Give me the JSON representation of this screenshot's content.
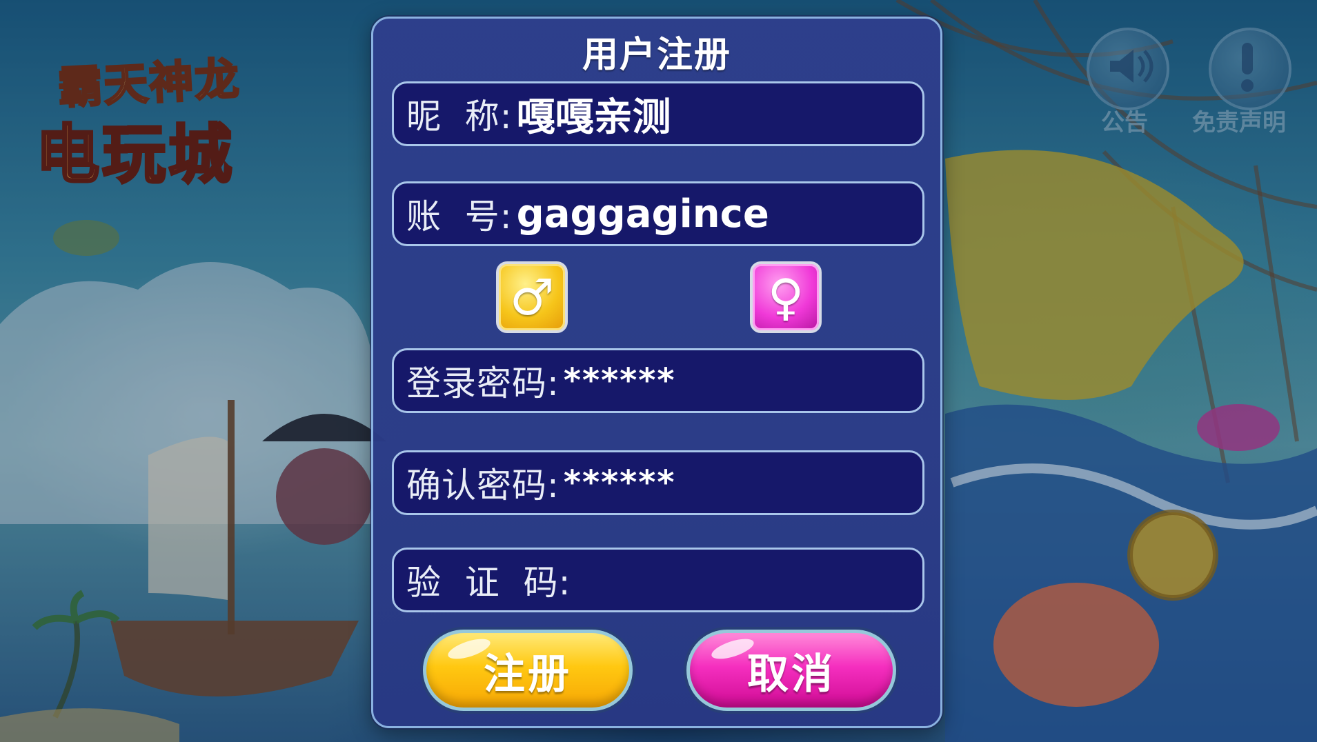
{
  "logo": {
    "line1": "霸天神龙",
    "line2": "电玩城"
  },
  "top_icons": [
    {
      "label": "公告",
      "icon": "announcement-speaker-icon"
    },
    {
      "label": "免责声明",
      "icon": "exclamation-icon"
    }
  ],
  "dialog": {
    "title": "用户注册",
    "fields": {
      "nickname": {
        "label": "昵  称:",
        "value": "嘎嘎亲测"
      },
      "account": {
        "label": "账  号:",
        "value": "gaggagince"
      },
      "password": {
        "label": "登录密码:",
        "value": "******"
      },
      "confirm_password": {
        "label": "确认密码:",
        "value": "******"
      },
      "captcha": {
        "label": "验  证  码:",
        "value": ""
      }
    },
    "gender": {
      "male_symbol": "♂",
      "female_symbol": "♀"
    },
    "buttons": {
      "register": "注册",
      "cancel": "取消"
    }
  },
  "colors": {
    "dialog_bg": "#2e3e8c",
    "field_bg": "#16186a",
    "register_button": "#ffc811",
    "cancel_button": "#f52fbf",
    "male_button": "#f6c51a",
    "female_button": "#f039d8"
  }
}
